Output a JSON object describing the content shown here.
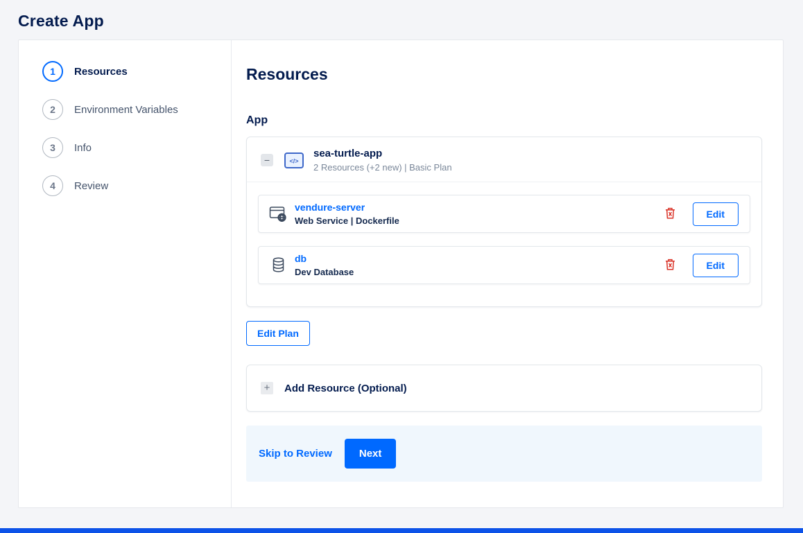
{
  "page": {
    "title": "Create App"
  },
  "stepper": {
    "steps": [
      {
        "number": "1",
        "label": "Resources"
      },
      {
        "number": "2",
        "label": "Environment Variables"
      },
      {
        "number": "3",
        "label": "Info"
      },
      {
        "number": "4",
        "label": "Review"
      }
    ]
  },
  "content": {
    "heading": "Resources",
    "section_label": "App",
    "app": {
      "name": "sea-turtle-app",
      "meta": "2 Resources (+2 new) | Basic Plan",
      "resources": [
        {
          "name": "vendure-server",
          "type": "Web Service | Dockerfile",
          "edit_label": "Edit"
        },
        {
          "name": "db",
          "type": "Dev Database",
          "edit_label": "Edit"
        }
      ]
    },
    "edit_plan_label": "Edit Plan",
    "add_resource": {
      "label": "Add Resource (Optional)"
    },
    "footer": {
      "skip_label": "Skip to Review",
      "next_label": "Next"
    }
  },
  "icons": {
    "collapse": "−",
    "plus": "+",
    "app_icon": "code-icon",
    "resource_icons": [
      "web-service-icon",
      "database-icon"
    ],
    "delete": "trash-icon"
  },
  "colors": {
    "primary": "#0069ff",
    "danger": "#d93025",
    "heading": "#031b4e",
    "footer_bg": "#f0f7fd",
    "page_bg": "#f4f5f8"
  }
}
